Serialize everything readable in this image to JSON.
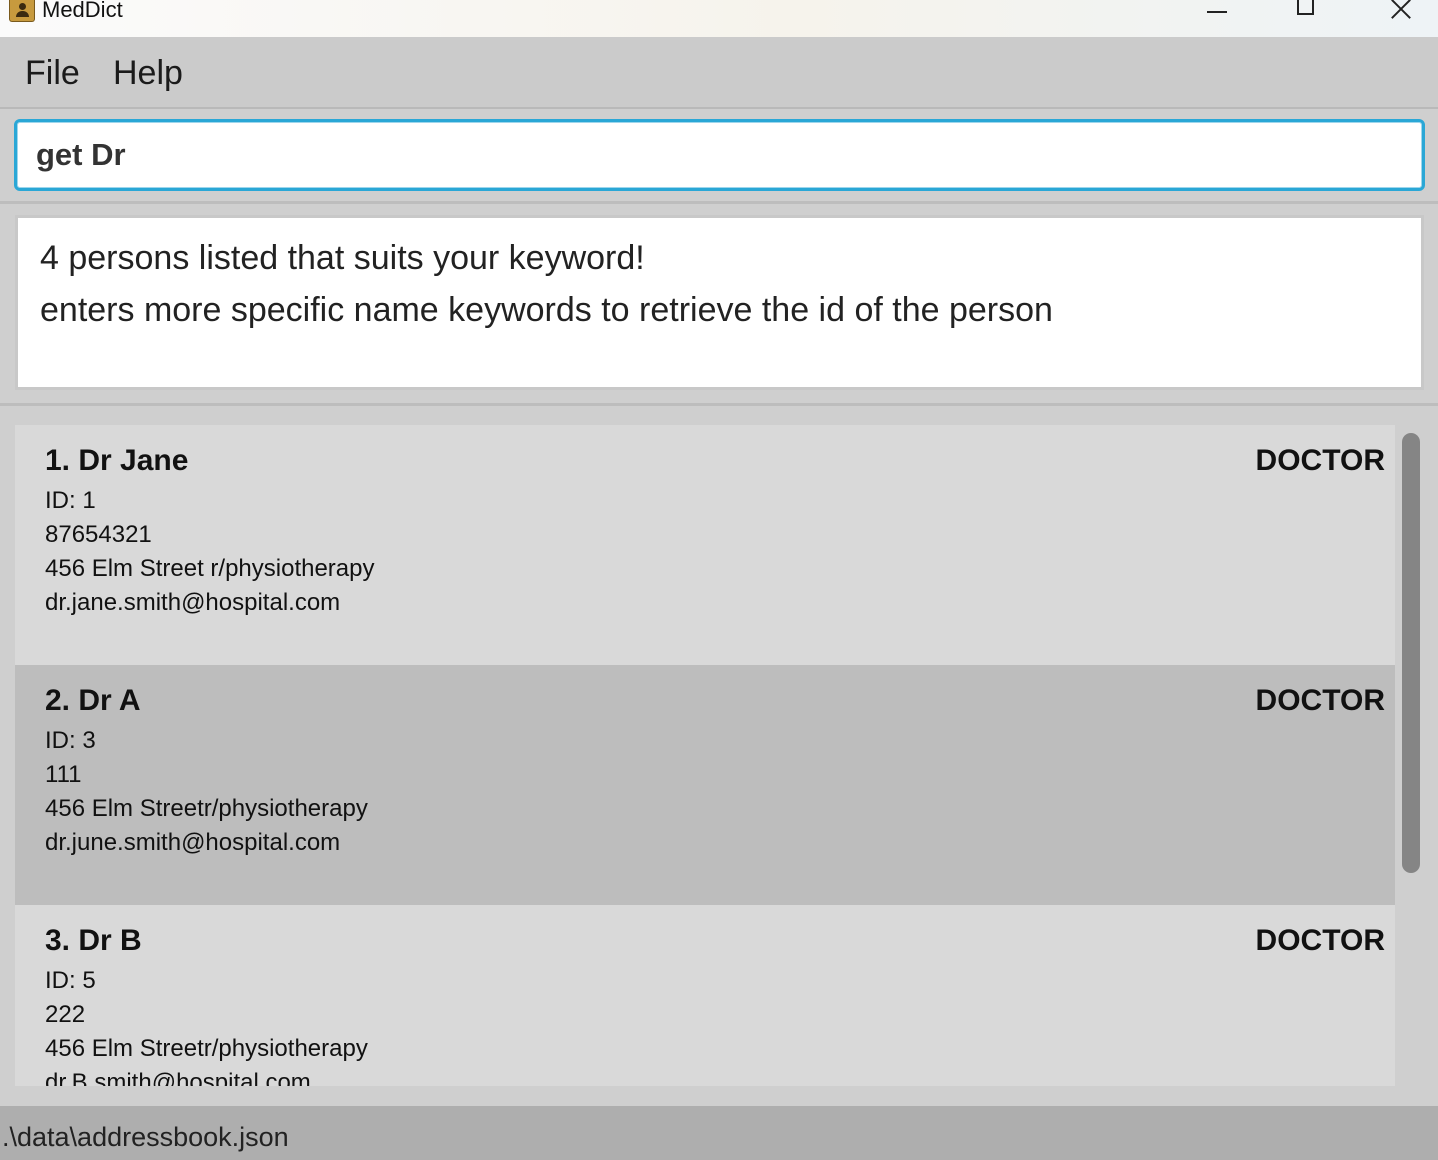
{
  "window": {
    "title": "MedDict",
    "controls": [
      "minimize-icon",
      "maximize-icon",
      "close-icon"
    ]
  },
  "menu": {
    "file_label": "File",
    "help_label": "Help"
  },
  "command": {
    "value": "get Dr"
  },
  "result": {
    "line1": "4 persons listed that suits your keyword!",
    "line2": "enters more specific name keywords to retrieve the id of the person"
  },
  "persons": [
    {
      "name": "1. Dr Jane",
      "role": "DOCTOR",
      "id": "ID: 1",
      "phone": "87654321",
      "address": "456 Elm Street r/physiotherapy",
      "email": "dr.jane.smith@hospital.com"
    },
    {
      "name": "2. Dr A",
      "role": "DOCTOR",
      "id": "ID: 3",
      "phone": "111",
      "address": "456 Elm Streetr/physiotherapy",
      "email": "dr.june.smith@hospital.com"
    },
    {
      "name": "3. Dr B",
      "role": "DOCTOR",
      "id": "ID: 5",
      "phone": "222",
      "address": "456 Elm Streetr/physiotherapy",
      "email": "dr.B.smith@hospital.com"
    }
  ],
  "status": {
    "file_path": ".\\data\\addressbook.json"
  },
  "colors": {
    "accent": "#2aa7d6",
    "card_light": "#d9d9d9",
    "card_selected": "#bdbdbd",
    "status_bar": "#aeaeae"
  }
}
